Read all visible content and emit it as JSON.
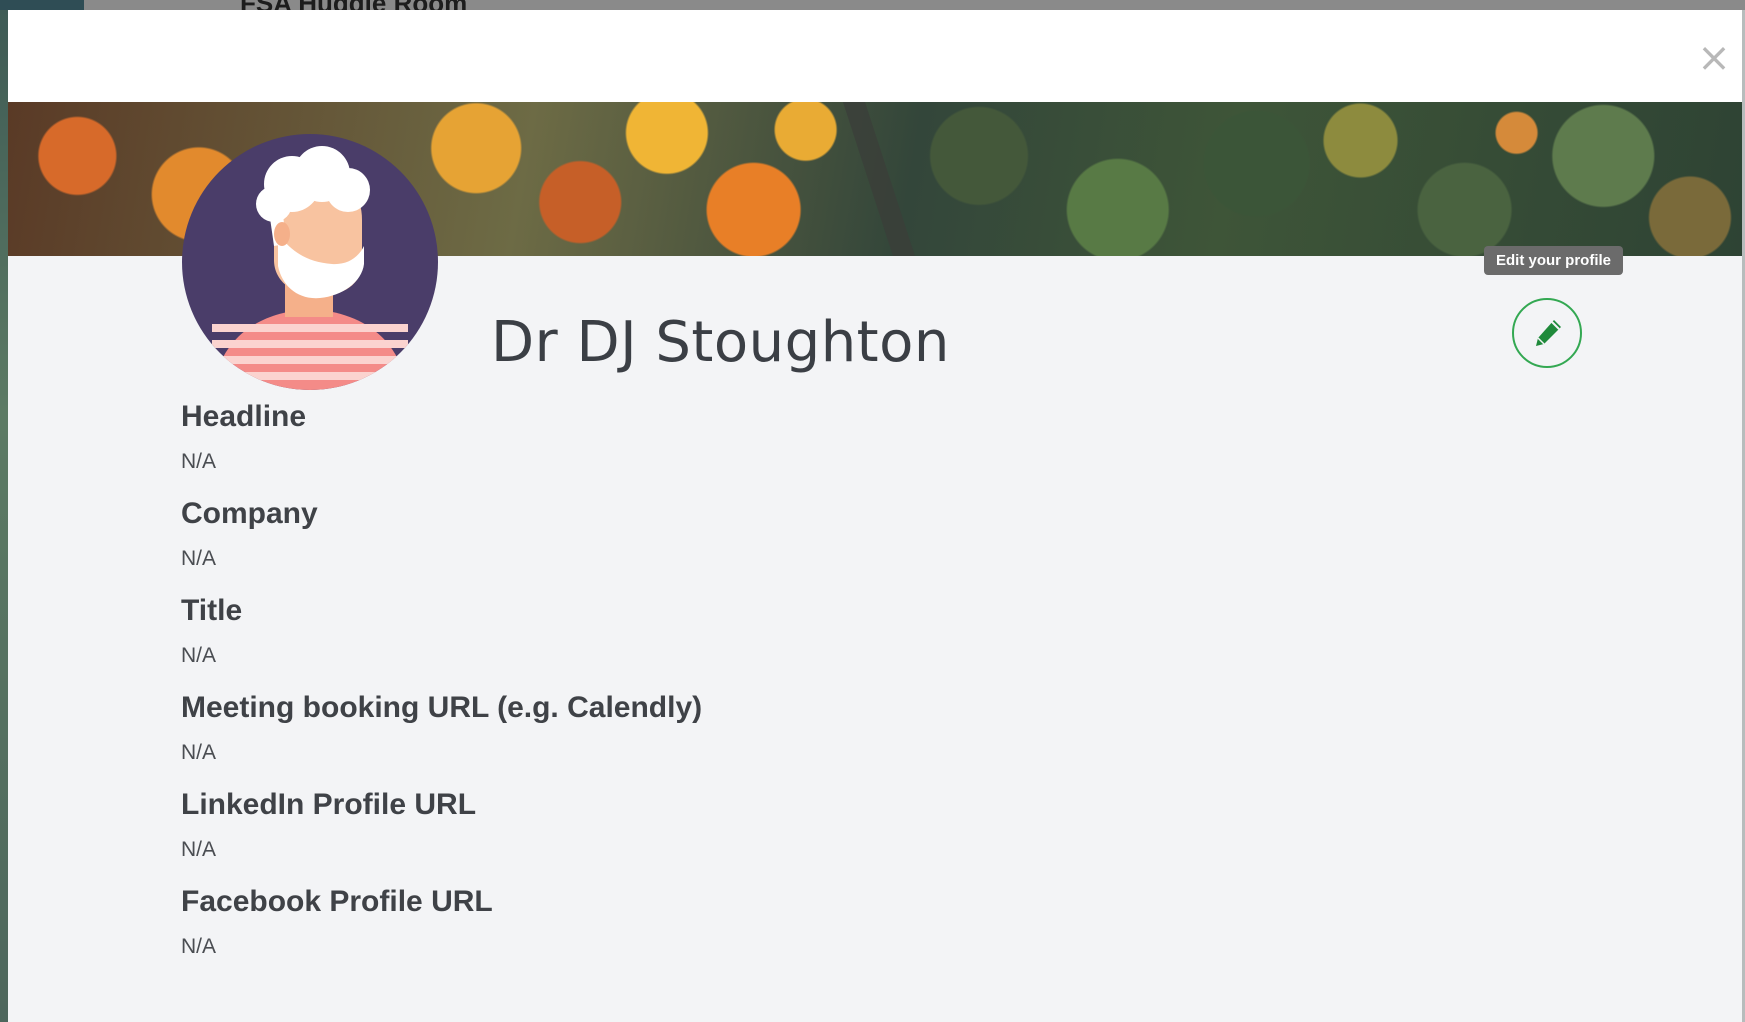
{
  "background": {
    "page_title": "FSA Huddle Room"
  },
  "modal": {
    "close_icon": "close-icon",
    "profile": {
      "name": "Dr DJ Stoughton",
      "edit_tooltip": "Edit your profile",
      "edit_icon": "pencil-icon",
      "accent_color": "#33a852"
    },
    "fields": [
      {
        "label": "Headline",
        "value": "N/A"
      },
      {
        "label": "Company",
        "value": "N/A"
      },
      {
        "label": "Title",
        "value": "N/A"
      },
      {
        "label": "Meeting booking URL (e.g. Calendly)",
        "value": "N/A"
      },
      {
        "label": "LinkedIn Profile URL",
        "value": "N/A"
      },
      {
        "label": "Facebook Profile URL",
        "value": "N/A"
      }
    ]
  }
}
